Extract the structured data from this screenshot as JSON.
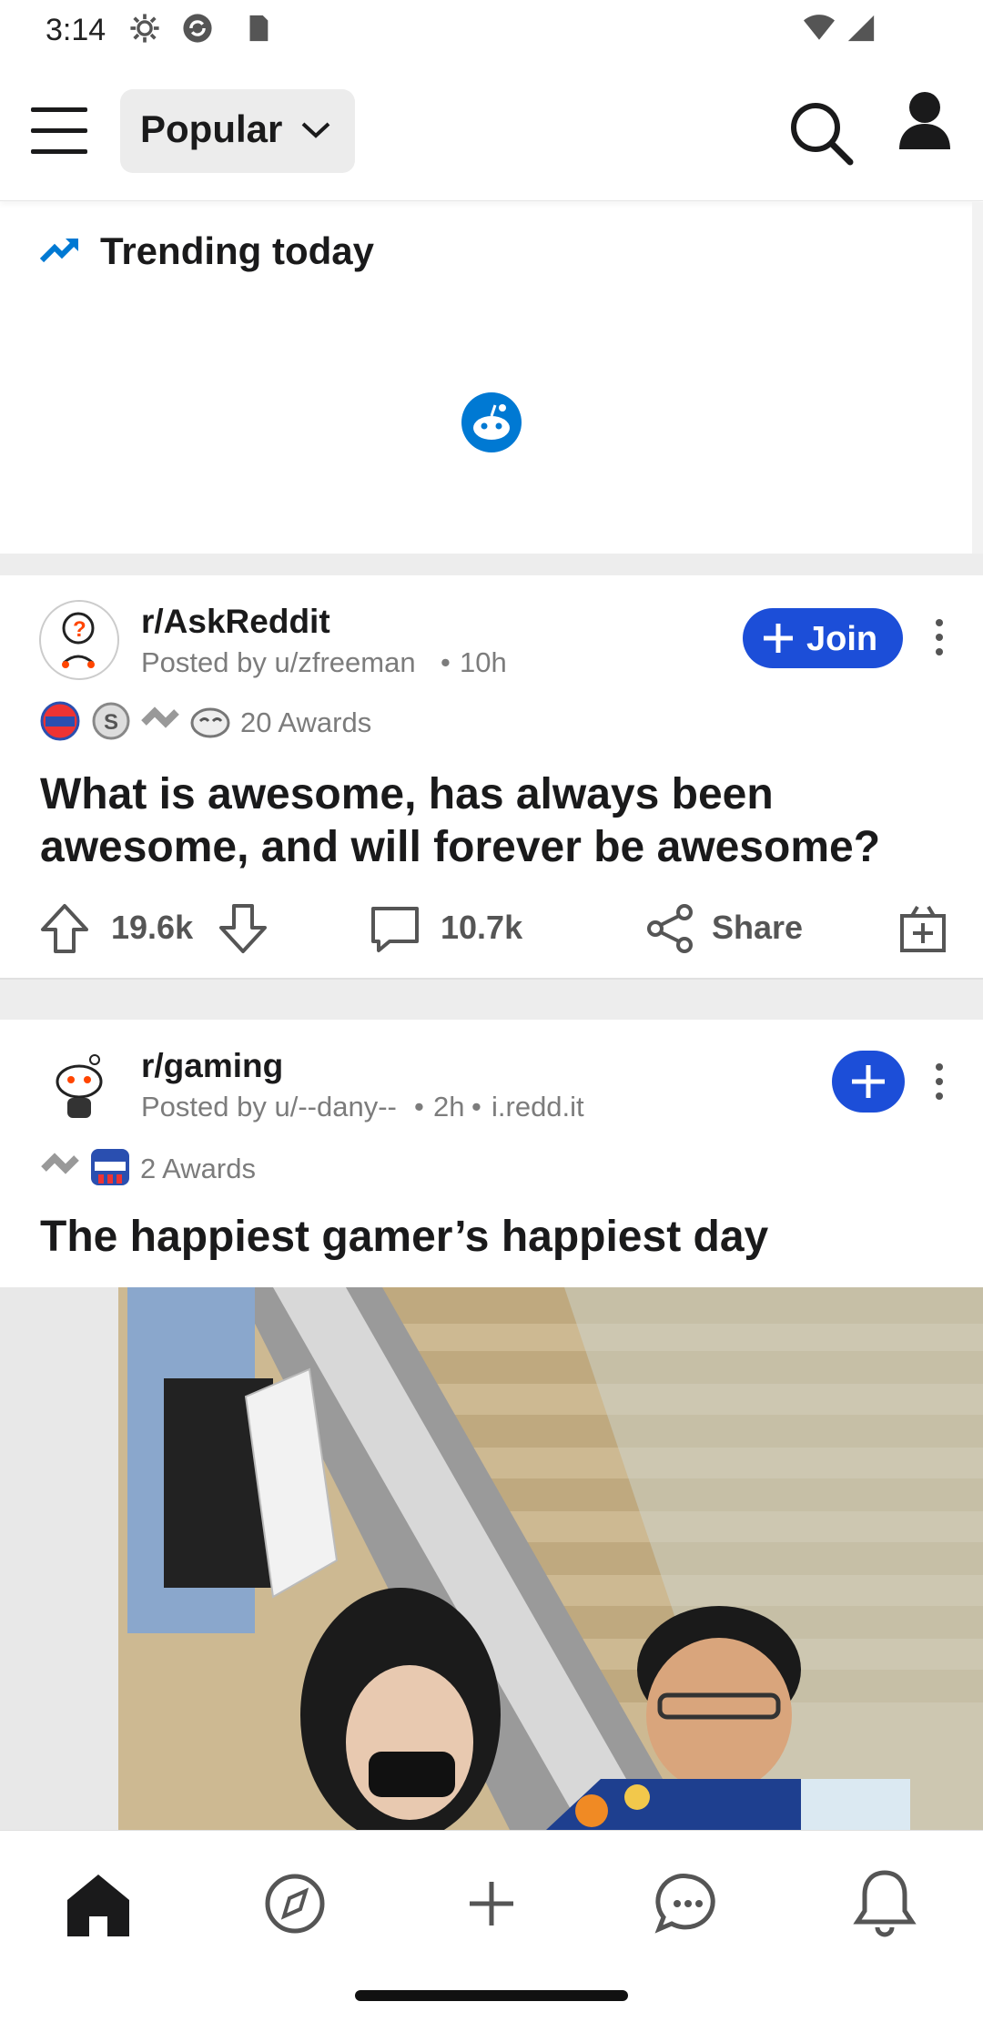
{
  "status_bar": {
    "time": "3:14"
  },
  "header": {
    "feed_selector_label": "Popular",
    "icons": [
      "menu-icon",
      "search-icon",
      "profile-icon"
    ]
  },
  "trending": {
    "title": "Trending today"
  },
  "posts": [
    {
      "subreddit": "r/AskReddit",
      "posted_by": "Posted by u/zfreeman",
      "time": "10h",
      "join_label": "Join",
      "awards_label": "20 Awards",
      "title": "What is awesome, has always been awesome, and will forever be awesome?",
      "upvotes": "19.6k",
      "comments": "10.7k",
      "share_label": "Share"
    },
    {
      "subreddit": "r/gaming",
      "posted_by": "Posted by u/--dany--",
      "time": "2h",
      "domain": "i.redd.it",
      "awards_label": "2 Awards",
      "title": "The happiest gamer’s happiest day"
    }
  ],
  "colors": {
    "accent": "#1c4ed8",
    "brand": "#0079d3",
    "orangered": "#ff4500"
  },
  "bottom_nav": {
    "items": [
      "home-icon",
      "discover-icon",
      "create-icon",
      "chat-icon",
      "inbox-icon"
    ]
  }
}
